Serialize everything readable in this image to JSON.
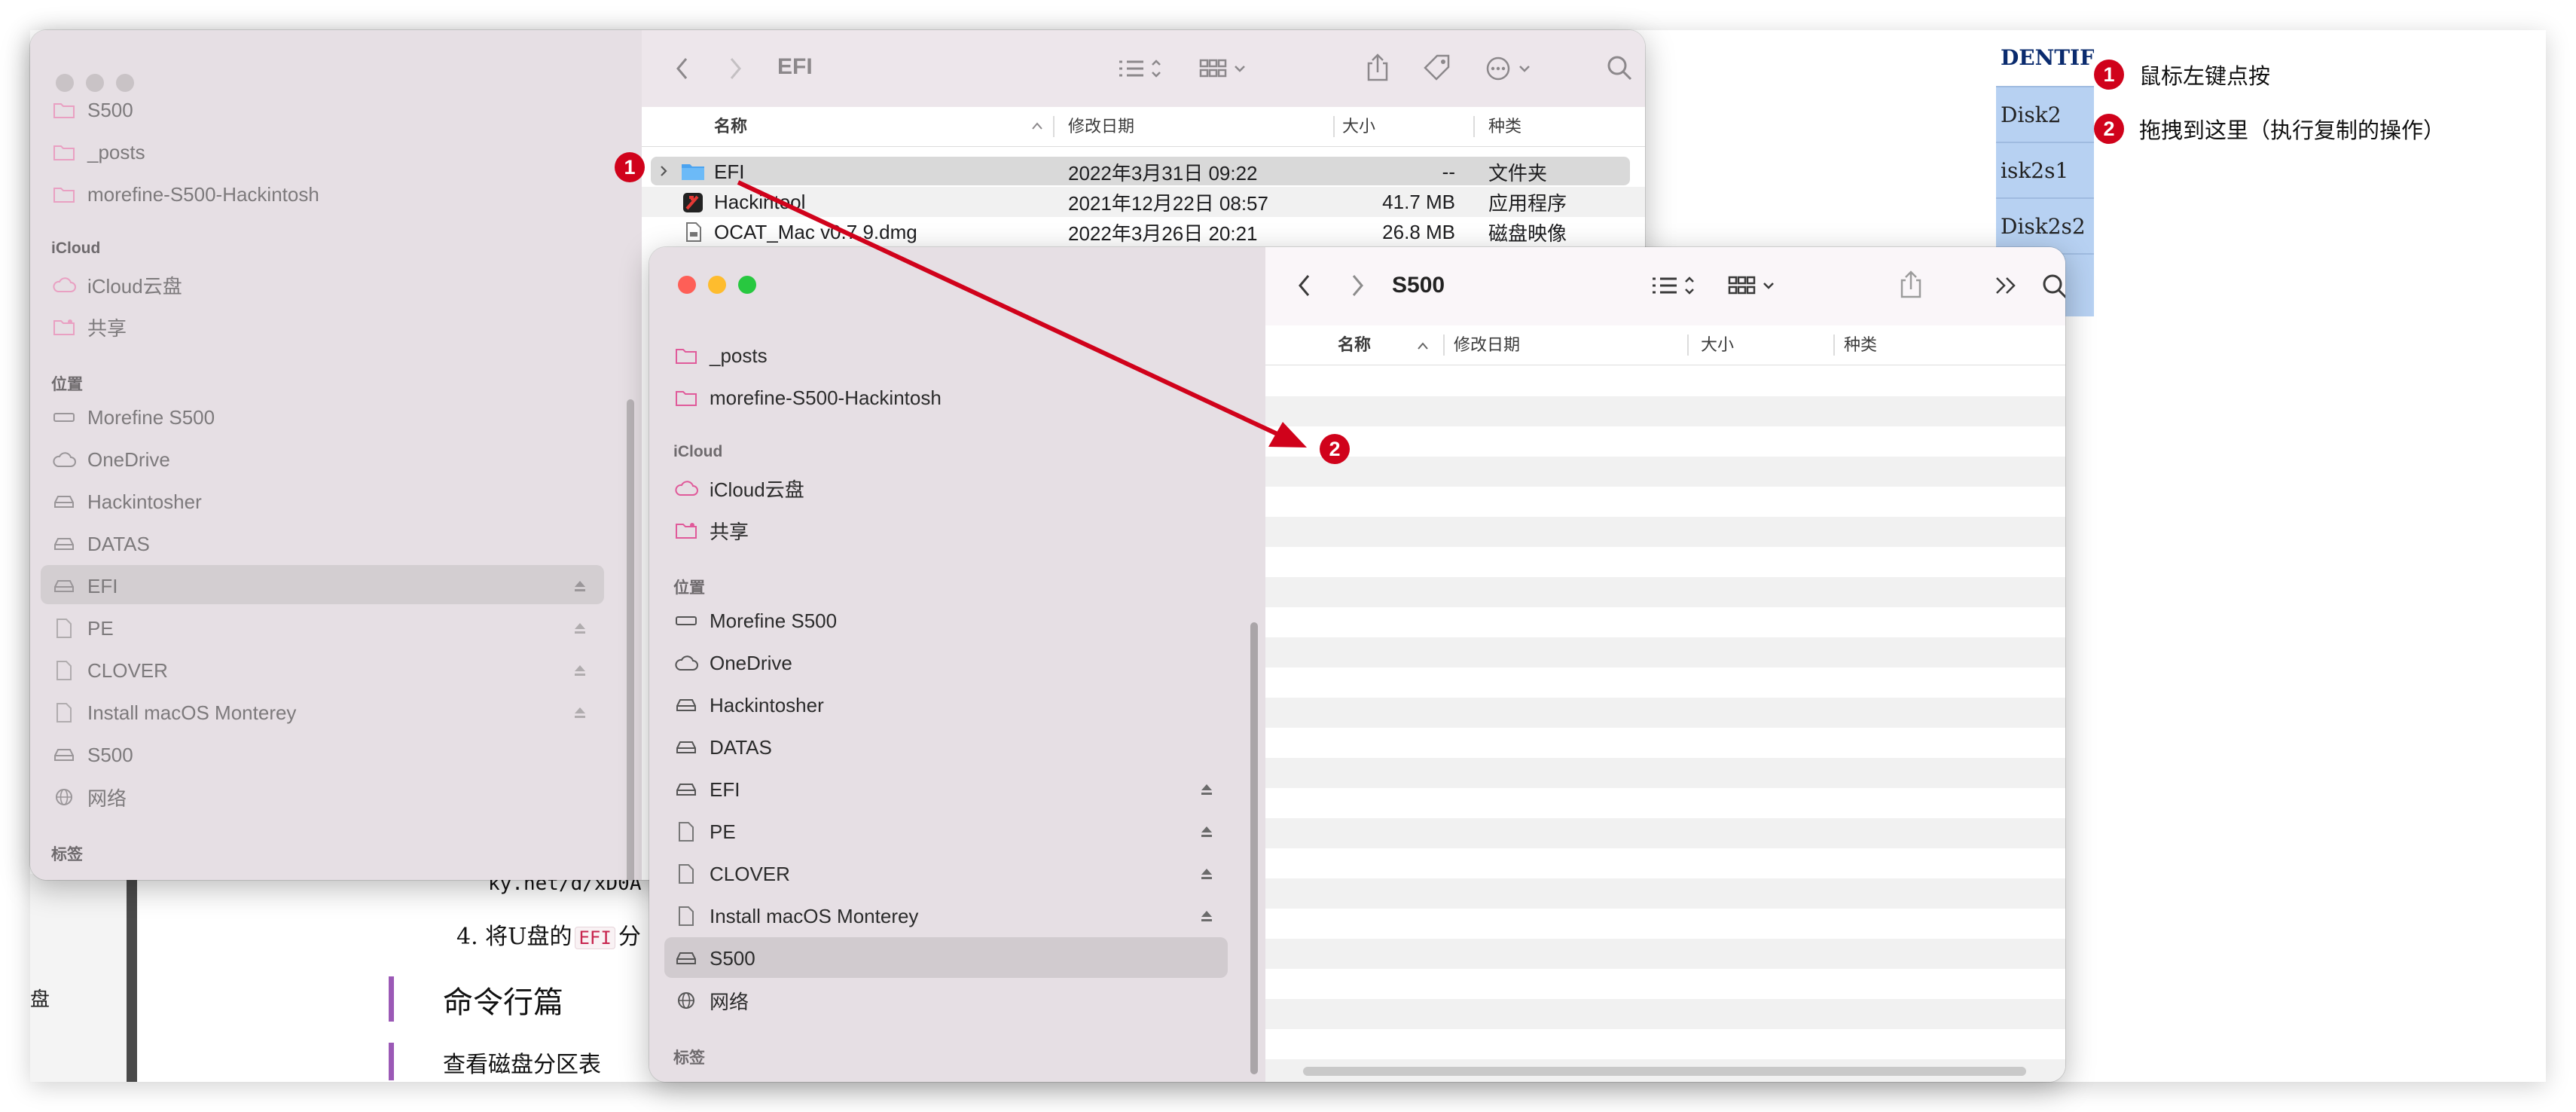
{
  "document": {
    "side_label": "盘",
    "url_fragment": "ky.net/d/xD0A",
    "step4_prefix": "4. 将U盘的",
    "step4_code": "EFI",
    "step4_suffix": "分",
    "heading": "命令行篇",
    "subheading": "查看磁盘分区表",
    "table_header": "DENTIFI",
    "table_cells": [
      "Disk2",
      "isk2s1",
      "Disk2s2"
    ]
  },
  "legend": [
    {
      "num": "1",
      "text": "鼠标左键点按"
    },
    {
      "num": "2",
      "text": "拖拽到这里（执行复制的操作）"
    }
  ],
  "window_back": {
    "title": "EFI",
    "sidebar": {
      "items_top": [
        "S500",
        "_posts",
        "morefine-S500-Hackintosh"
      ],
      "icloud_header": "iCloud",
      "icloud_items": [
        "iCloud云盘",
        "共享"
      ],
      "locations_header": "位置",
      "locations": [
        "Morefine S500",
        "OneDrive",
        "Hackintosher",
        "DATAS",
        "EFI",
        "PE",
        "CLOVER",
        "Install macOS Monterey",
        "S500",
        "网络"
      ],
      "tags_header": "标签"
    },
    "columns": {
      "name": "名称",
      "date": "修改日期",
      "size": "大小",
      "kind": "种类"
    },
    "files": [
      {
        "name": "EFI",
        "date": "2022年3月31日 09:22",
        "size": "--",
        "kind": "文件夹"
      },
      {
        "name": "Hackintool",
        "date": "2021年12月22日 08:57",
        "size": "41.7 MB",
        "kind": "应用程序"
      },
      {
        "name": "OCAT_Mac v0.7.9.dmg",
        "date": "2022年3月26日 20:21",
        "size": "26.8 MB",
        "kind": "磁盘映像"
      }
    ]
  },
  "window_front": {
    "title": "S500",
    "sidebar": {
      "items_top": [
        "_posts",
        "morefine-S500-Hackintosh"
      ],
      "icloud_header": "iCloud",
      "icloud_items": [
        "iCloud云盘",
        "共享"
      ],
      "locations_header": "位置",
      "locations": [
        "Morefine S500",
        "OneDrive",
        "Hackintosher",
        "DATAS",
        "EFI",
        "PE",
        "CLOVER",
        "Install macOS Monterey",
        "S500",
        "网络"
      ],
      "tags_header": "标签"
    },
    "columns": {
      "name": "名称",
      "date": "修改日期",
      "size": "大小",
      "kind": "种类"
    }
  },
  "annotations": {
    "start_marker": "1",
    "end_marker": "2",
    "arrow_color": "#d0021b"
  },
  "colors": {
    "accent": "#d0021b",
    "sidebar_bg": "#e6dfe4",
    "selection": "#d3ced1",
    "folder_blue": "#4aa3f0",
    "icon_pink": "#e05a9a"
  }
}
